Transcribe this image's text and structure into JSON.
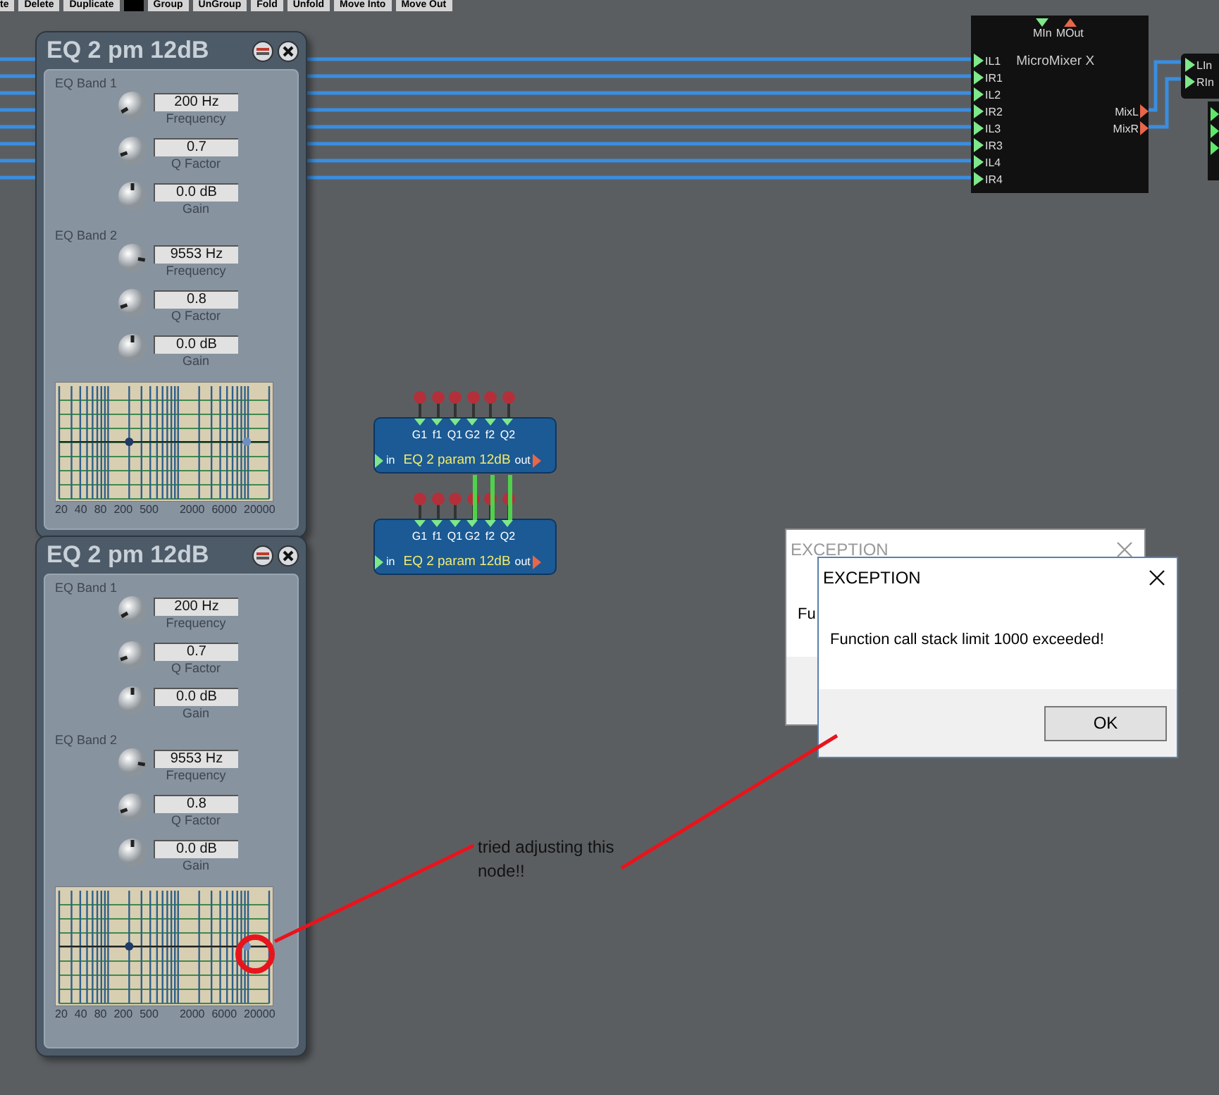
{
  "toolbar": {
    "buttons": [
      {
        "kind": "button",
        "label": "te"
      },
      {
        "kind": "button",
        "label": "Delete"
      },
      {
        "kind": "button",
        "label": "Duplicate"
      },
      {
        "kind": "swatch"
      },
      {
        "kind": "button",
        "label": "Group"
      },
      {
        "kind": "button",
        "label": "UnGroup"
      },
      {
        "kind": "button",
        "label": "Fold"
      },
      {
        "kind": "button",
        "label": "Unfold"
      },
      {
        "kind": "button",
        "label": "Move Into"
      },
      {
        "kind": "button",
        "label": "Move Out"
      }
    ]
  },
  "eq_panels": [
    {
      "title": "EQ 2 pm 12dB",
      "bands": [
        {
          "label": "EQ Band 1",
          "params": [
            {
              "value": "200 Hz",
              "label": "Frequency"
            },
            {
              "value": "0.7",
              "label": "Q Factor"
            },
            {
              "value": "0.0 dB",
              "label": "Gain"
            }
          ]
        },
        {
          "label": "EQ Band 2",
          "params": [
            {
              "value": "9553 Hz",
              "label": "Frequency"
            },
            {
              "value": "0.8",
              "label": "Q Factor"
            },
            {
              "value": "0.0 dB",
              "label": "Gain"
            }
          ]
        }
      ],
      "freq_labels": [
        "20",
        "40",
        "80",
        "200",
        "500",
        "2000",
        "6000",
        "20000"
      ]
    },
    {
      "title": "EQ 2 pm 12dB",
      "bands": [
        {
          "label": "EQ Band 1",
          "params": [
            {
              "value": "200 Hz",
              "label": "Frequency"
            },
            {
              "value": "0.7",
              "label": "Q Factor"
            },
            {
              "value": "0.0 dB",
              "label": "Gain"
            }
          ]
        },
        {
          "label": "EQ Band 2",
          "params": [
            {
              "value": "9553 Hz",
              "label": "Frequency"
            },
            {
              "value": "0.8",
              "label": "Q Factor"
            },
            {
              "value": "0.0 dB",
              "label": "Gain"
            }
          ]
        }
      ],
      "freq_labels": [
        "20",
        "40",
        "80",
        "200",
        "500",
        "2000",
        "6000",
        "20000"
      ]
    }
  ],
  "modules": [
    {
      "ports": [
        "G1",
        "f1",
        "Q1",
        "G2",
        "f2",
        "Q2"
      ],
      "input": "in",
      "title": "EQ 2 param 12dB",
      "output": "out"
    },
    {
      "ports": [
        "G1",
        "f1",
        "Q1",
        "G2",
        "f2",
        "Q2"
      ],
      "input": "in",
      "title": "EQ 2 param 12dB",
      "output": "out"
    }
  ],
  "mixer": {
    "top_ports": [
      "MIn",
      "MOut"
    ],
    "title": "MicroMixer X",
    "inputs": [
      "IL1",
      "IR1",
      "IL2",
      "IR2",
      "IL3",
      "IR3",
      "IL4",
      "IR4"
    ],
    "outputs": [
      "MixL",
      "MixR"
    ]
  },
  "stereo_input": {
    "ports": [
      "LIn",
      "RIn"
    ]
  },
  "dialogs": [
    {
      "title": "EXCEPTION",
      "message": "Fu",
      "active": false
    },
    {
      "title": "EXCEPTION",
      "message": "Function call stack limit 1000 exceeded!",
      "button": "OK",
      "active": true
    }
  ],
  "annotation": {
    "text": "tried adjusting this node!!"
  }
}
